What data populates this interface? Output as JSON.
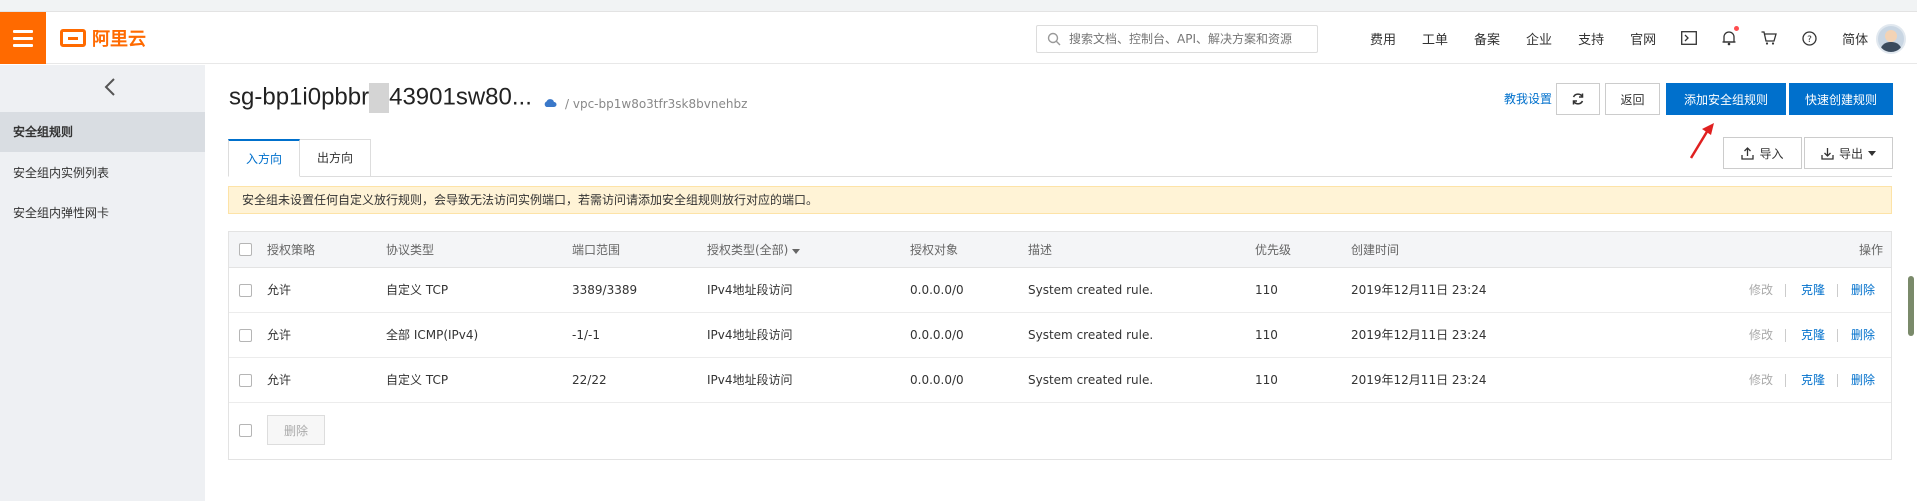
{
  "header": {
    "logo_text": "阿里云",
    "search_placeholder": "搜索文档、控制台、API、解决方案和资源",
    "nav": [
      "费用",
      "工单",
      "备案",
      "企业",
      "支持",
      "官网"
    ],
    "lang": "简体"
  },
  "sidebar": {
    "items": [
      {
        "label": "安全组规则"
      },
      {
        "label": "安全组内实例列表"
      },
      {
        "label": "安全组内弹性网卡"
      }
    ]
  },
  "page": {
    "title_prefix": "sg-bp1i0pbbr",
    "title_suffix": "43901sw80...",
    "vpc": "/ vpc-bp1w8o3tfr3sk8bvnehbz",
    "teach_link": "教我设置",
    "back_label": "返回",
    "add_rule_label": "添加安全组规则",
    "quick_rule_label": "快速创建规则",
    "import_label": "导入",
    "export_label": "导出",
    "tabs": [
      "入方向",
      "出方向"
    ],
    "warning": "安全组未设置任何自定义放行规则，会导致无法访问实例端口，若需访问请添加安全组规则放行对应的端口。"
  },
  "table": {
    "columns": [
      "授权策略",
      "协议类型",
      "端口范围",
      "授权类型(全部)",
      "授权对象",
      "描述",
      "优先级",
      "创建时间",
      "操作"
    ],
    "rows": [
      {
        "policy": "允许",
        "protocol": "自定义 TCP",
        "port": "3389/3389",
        "auth_type": "IPv4地址段访问",
        "target": "0.0.0.0/0",
        "desc": "System created rule.",
        "priority": "110",
        "created": "2019年12月11日 23:24"
      },
      {
        "policy": "允许",
        "protocol": "全部 ICMP(IPv4)",
        "port": "-1/-1",
        "auth_type": "IPv4地址段访问",
        "target": "0.0.0.0/0",
        "desc": "System created rule.",
        "priority": "110",
        "created": "2019年12月11日 23:24"
      },
      {
        "policy": "允许",
        "protocol": "自定义 TCP",
        "port": "22/22",
        "auth_type": "IPv4地址段访问",
        "target": "0.0.0.0/0",
        "desc": "System created rule.",
        "priority": "110",
        "created": "2019年12月11日 23:24"
      }
    ],
    "ops": {
      "edit": "修改",
      "clone": "克隆",
      "delete": "删除"
    },
    "bulk_delete": "删除"
  },
  "colors": {
    "brand": "#ff6a00",
    "primary": "#0070cc",
    "warning_bg": "#fff3d6"
  }
}
